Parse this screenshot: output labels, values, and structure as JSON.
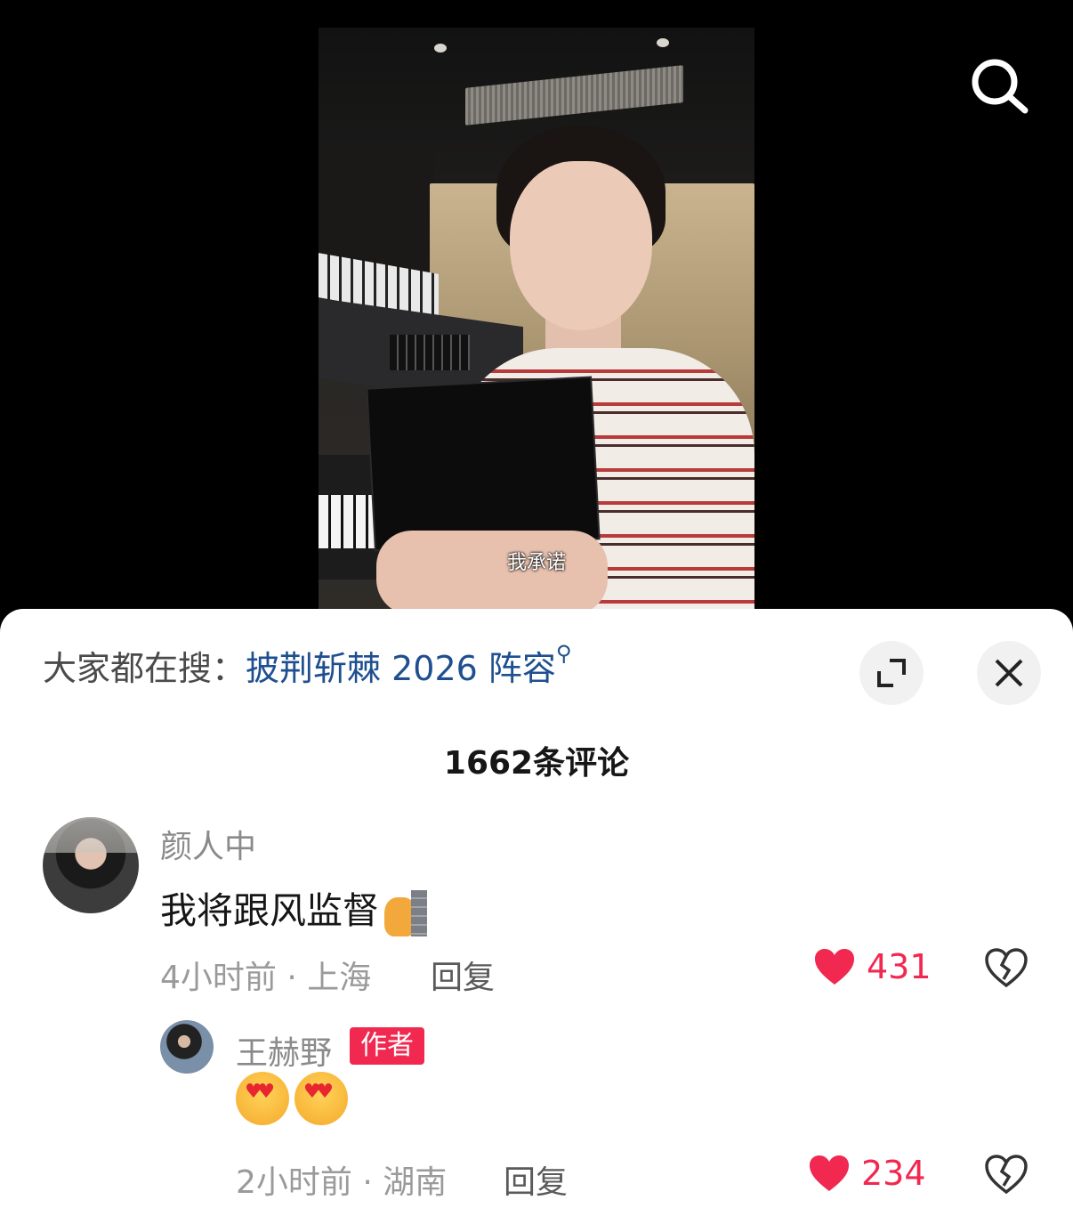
{
  "video": {
    "subtitle": "我承诺"
  },
  "header": {
    "search_icon": "search-icon"
  },
  "sheet": {
    "trending_prefix": "大家都在搜：",
    "trending_keyword": "披荆斩棘 2026 阵容",
    "expand_icon": "expand-icon",
    "close_icon": "close-icon",
    "comment_count": "1662条评论"
  },
  "comments": [
    {
      "username": "颜人中",
      "text": "我将跟风监督",
      "emoji": "bear-peeking-wall-emoji",
      "time_location": "4小时前 · 上海",
      "reply_label": "回复",
      "likes": "431"
    }
  ],
  "reply": {
    "username": "王赫野",
    "badge": "作者",
    "emojis": [
      "heart-eyes-kiss-emoji",
      "heart-eyes-kiss-emoji"
    ],
    "time_location": "2小时前 · 湖南",
    "reply_label": "回复",
    "likes": "234"
  },
  "colors": {
    "accent": "#f1284f",
    "link": "#1e4f8f"
  }
}
